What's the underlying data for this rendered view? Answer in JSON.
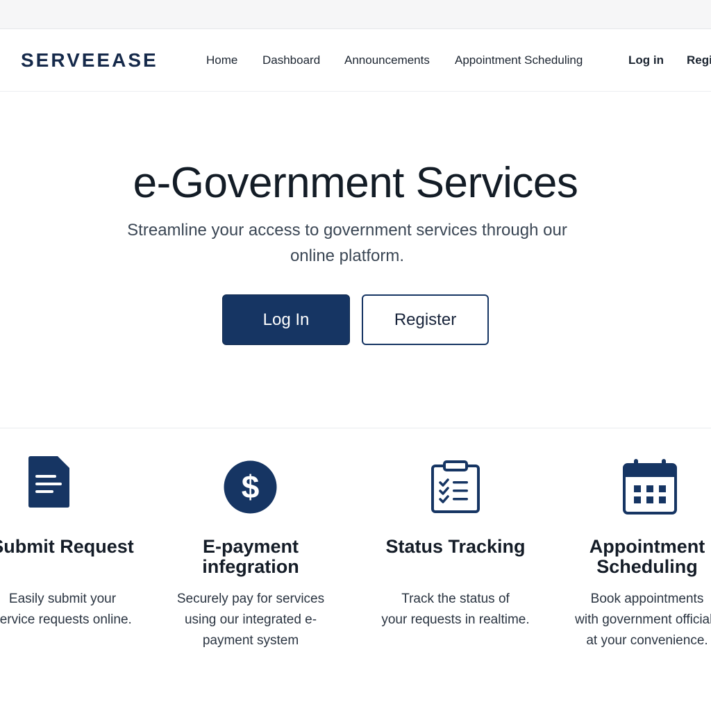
{
  "brand": {
    "name": "SERVEEASE",
    "accent": "#163563"
  },
  "nav": {
    "links": [
      "Home",
      "Dashboard",
      "Announcements",
      "Appointment Scheduling"
    ],
    "login": "Log in",
    "register": "Register"
  },
  "hero": {
    "title": "e-Government Services",
    "subtitle_line1": "Streamline your access to government services through our",
    "subtitle_line2": "online platform.",
    "login_button": "Log In",
    "register_button": "Register"
  },
  "features": [
    {
      "icon": "document-icon",
      "title": "Submit Request",
      "desc1": "Easily submit your",
      "desc2": "service requests online."
    },
    {
      "icon": "dollar-icon",
      "title1": "E-payment",
      "title2": "infegration",
      "desc1": "Securely pay for services",
      "desc2": "using our integrated e-",
      "desc3": "payment system"
    },
    {
      "icon": "checklist-icon",
      "title": "Status Tracking",
      "desc1": "Track the status of",
      "desc2": "your requests in realtime."
    },
    {
      "icon": "calendar-icon",
      "title1": "Appointment",
      "title2": "Scheduling",
      "desc1": "Book appointments",
      "desc2": "with government officials",
      "desc3": "at your convenience."
    }
  ]
}
